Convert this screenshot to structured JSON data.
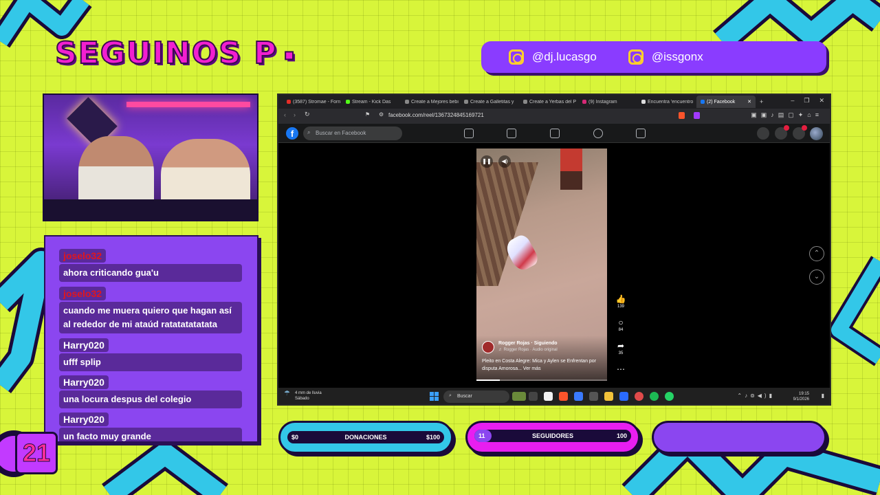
{
  "overlay": {
    "title": "SEGUINOS P",
    "social": [
      {
        "icon": "instagram-icon",
        "handle": "@dj.lucasgo"
      },
      {
        "icon": "instagram-icon",
        "handle": "@issgonx"
      }
    ],
    "logo_text": "21",
    "colors": {
      "background": "#d8f53a",
      "accent_purple": "#8b46f0",
      "accent_pink": "#f21fd0",
      "accent_cyan": "#33c7e8"
    }
  },
  "chat": {
    "messages": [
      {
        "user": "joselo32",
        "text": "ahora criticando gua'u"
      },
      {
        "user": "joselo32",
        "text": "cuando me muera quiero que hagan así al rededor de mi ataúd ratatatatatata"
      },
      {
        "user": "Harry020",
        "text": "ufff splip"
      },
      {
        "user": "Harry020",
        "text": "una locura despus del colegio"
      },
      {
        "user": "Harry020",
        "text": "un facto muy grande"
      }
    ]
  },
  "browser": {
    "tabs": [
      {
        "label": "(3587) Stromae - Forn",
        "color": "#e52d27"
      },
      {
        "label": "Stream - Kick Das",
        "color": "#53fc18"
      },
      {
        "label": "Create a Mejores bebi",
        "color": "#888888"
      },
      {
        "label": "Create a Galletitas y",
        "color": "#888888"
      },
      {
        "label": "Create a Yerbas del P",
        "color": "#888888"
      },
      {
        "label": "(9) Instagram",
        "color": "#d62976"
      },
      {
        "label": "Encuentra 'encuentro",
        "color": "#dddddd"
      },
      {
        "label": "(2) Facebook",
        "color": "#1877f2",
        "active": true
      }
    ],
    "url": "facebook.com/reel/1367324845169721",
    "facebook": {
      "search_placeholder": "Buscar en Facebook",
      "reel": {
        "author": "Rogger Rojas · Siguiendo",
        "audio": "♬ Rogger Rojas · Audio original",
        "caption": "Pleito en Costa Alegre: Mica y Aylen se Enfrentan por disputa Amorosa... Ver más",
        "progress": 0.18,
        "likes": "139",
        "comments": "84",
        "shares": "35"
      }
    },
    "taskbar": {
      "weather_line1": "4 mm de lluvia",
      "weather_line2": "Sábado",
      "search": "Buscar",
      "time": "19:15",
      "date": "9/1/2026"
    }
  },
  "stats": {
    "donations": {
      "left": "$0",
      "label": "DONACIONES",
      "right": "$100",
      "progress": 0.0
    },
    "followers": {
      "left": "11",
      "label": "SEGUIDORES",
      "right": "100",
      "progress": 0.11
    }
  }
}
